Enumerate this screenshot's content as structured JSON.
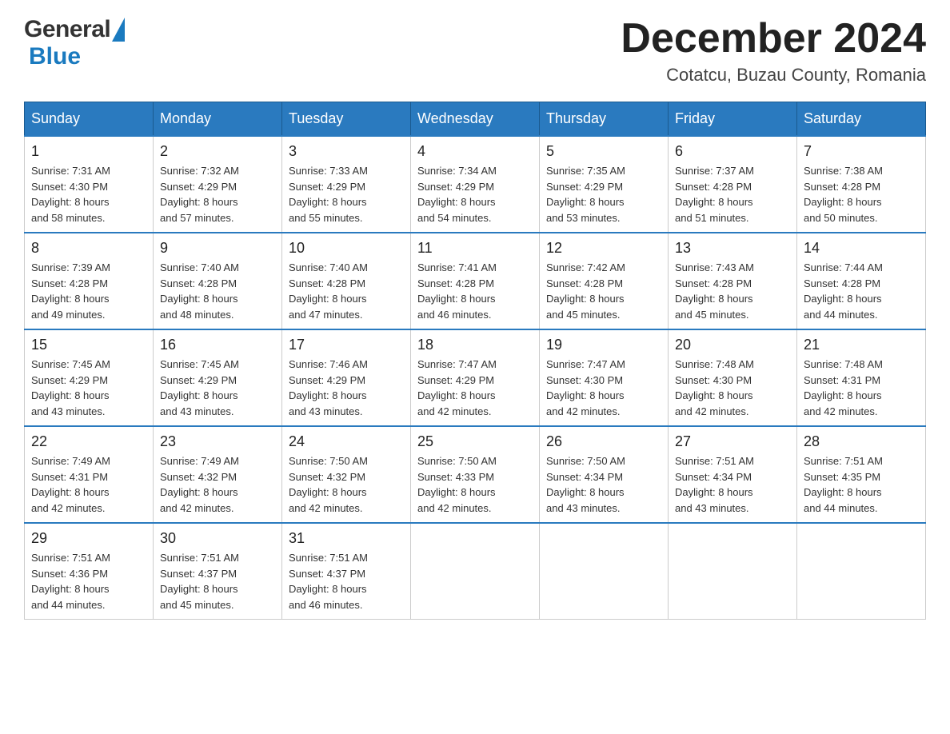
{
  "header": {
    "logo_general": "General",
    "logo_blue": "Blue",
    "month_title": "December 2024",
    "subtitle": "Cotatcu, Buzau County, Romania"
  },
  "days_of_week": [
    "Sunday",
    "Monday",
    "Tuesday",
    "Wednesday",
    "Thursday",
    "Friday",
    "Saturday"
  ],
  "weeks": [
    [
      {
        "day": "1",
        "info": "Sunrise: 7:31 AM\nSunset: 4:30 PM\nDaylight: 8 hours\nand 58 minutes."
      },
      {
        "day": "2",
        "info": "Sunrise: 7:32 AM\nSunset: 4:29 PM\nDaylight: 8 hours\nand 57 minutes."
      },
      {
        "day": "3",
        "info": "Sunrise: 7:33 AM\nSunset: 4:29 PM\nDaylight: 8 hours\nand 55 minutes."
      },
      {
        "day": "4",
        "info": "Sunrise: 7:34 AM\nSunset: 4:29 PM\nDaylight: 8 hours\nand 54 minutes."
      },
      {
        "day": "5",
        "info": "Sunrise: 7:35 AM\nSunset: 4:29 PM\nDaylight: 8 hours\nand 53 minutes."
      },
      {
        "day": "6",
        "info": "Sunrise: 7:37 AM\nSunset: 4:28 PM\nDaylight: 8 hours\nand 51 minutes."
      },
      {
        "day": "7",
        "info": "Sunrise: 7:38 AM\nSunset: 4:28 PM\nDaylight: 8 hours\nand 50 minutes."
      }
    ],
    [
      {
        "day": "8",
        "info": "Sunrise: 7:39 AM\nSunset: 4:28 PM\nDaylight: 8 hours\nand 49 minutes."
      },
      {
        "day": "9",
        "info": "Sunrise: 7:40 AM\nSunset: 4:28 PM\nDaylight: 8 hours\nand 48 minutes."
      },
      {
        "day": "10",
        "info": "Sunrise: 7:40 AM\nSunset: 4:28 PM\nDaylight: 8 hours\nand 47 minutes."
      },
      {
        "day": "11",
        "info": "Sunrise: 7:41 AM\nSunset: 4:28 PM\nDaylight: 8 hours\nand 46 minutes."
      },
      {
        "day": "12",
        "info": "Sunrise: 7:42 AM\nSunset: 4:28 PM\nDaylight: 8 hours\nand 45 minutes."
      },
      {
        "day": "13",
        "info": "Sunrise: 7:43 AM\nSunset: 4:28 PM\nDaylight: 8 hours\nand 45 minutes."
      },
      {
        "day": "14",
        "info": "Sunrise: 7:44 AM\nSunset: 4:28 PM\nDaylight: 8 hours\nand 44 minutes."
      }
    ],
    [
      {
        "day": "15",
        "info": "Sunrise: 7:45 AM\nSunset: 4:29 PM\nDaylight: 8 hours\nand 43 minutes."
      },
      {
        "day": "16",
        "info": "Sunrise: 7:45 AM\nSunset: 4:29 PM\nDaylight: 8 hours\nand 43 minutes."
      },
      {
        "day": "17",
        "info": "Sunrise: 7:46 AM\nSunset: 4:29 PM\nDaylight: 8 hours\nand 43 minutes."
      },
      {
        "day": "18",
        "info": "Sunrise: 7:47 AM\nSunset: 4:29 PM\nDaylight: 8 hours\nand 42 minutes."
      },
      {
        "day": "19",
        "info": "Sunrise: 7:47 AM\nSunset: 4:30 PM\nDaylight: 8 hours\nand 42 minutes."
      },
      {
        "day": "20",
        "info": "Sunrise: 7:48 AM\nSunset: 4:30 PM\nDaylight: 8 hours\nand 42 minutes."
      },
      {
        "day": "21",
        "info": "Sunrise: 7:48 AM\nSunset: 4:31 PM\nDaylight: 8 hours\nand 42 minutes."
      }
    ],
    [
      {
        "day": "22",
        "info": "Sunrise: 7:49 AM\nSunset: 4:31 PM\nDaylight: 8 hours\nand 42 minutes."
      },
      {
        "day": "23",
        "info": "Sunrise: 7:49 AM\nSunset: 4:32 PM\nDaylight: 8 hours\nand 42 minutes."
      },
      {
        "day": "24",
        "info": "Sunrise: 7:50 AM\nSunset: 4:32 PM\nDaylight: 8 hours\nand 42 minutes."
      },
      {
        "day": "25",
        "info": "Sunrise: 7:50 AM\nSunset: 4:33 PM\nDaylight: 8 hours\nand 42 minutes."
      },
      {
        "day": "26",
        "info": "Sunrise: 7:50 AM\nSunset: 4:34 PM\nDaylight: 8 hours\nand 43 minutes."
      },
      {
        "day": "27",
        "info": "Sunrise: 7:51 AM\nSunset: 4:34 PM\nDaylight: 8 hours\nand 43 minutes."
      },
      {
        "day": "28",
        "info": "Sunrise: 7:51 AM\nSunset: 4:35 PM\nDaylight: 8 hours\nand 44 minutes."
      }
    ],
    [
      {
        "day": "29",
        "info": "Sunrise: 7:51 AM\nSunset: 4:36 PM\nDaylight: 8 hours\nand 44 minutes."
      },
      {
        "day": "30",
        "info": "Sunrise: 7:51 AM\nSunset: 4:37 PM\nDaylight: 8 hours\nand 45 minutes."
      },
      {
        "day": "31",
        "info": "Sunrise: 7:51 AM\nSunset: 4:37 PM\nDaylight: 8 hours\nand 46 minutes."
      },
      {
        "day": "",
        "info": ""
      },
      {
        "day": "",
        "info": ""
      },
      {
        "day": "",
        "info": ""
      },
      {
        "day": "",
        "info": ""
      }
    ]
  ],
  "colors": {
    "header_bg": "#2a7abf",
    "header_text": "#ffffff",
    "border_top": "#2a7abf",
    "logo_blue": "#1a7abf"
  }
}
